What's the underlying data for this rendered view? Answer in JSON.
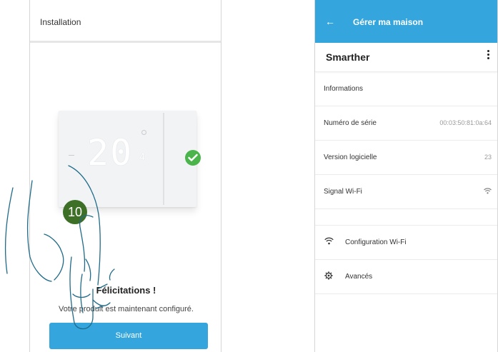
{
  "left": {
    "header_title": "Installation",
    "device_display": "20",
    "device_unit": "4",
    "step_number": "10",
    "congrats": "Félicitations !",
    "subtitle": "Votre produit est maintenant configuré.",
    "button": "Suivant"
  },
  "right": {
    "back_icon": "←",
    "header_title": "Gérer ma maison",
    "device_name": "Smarther",
    "section": "Informations",
    "rows": [
      {
        "label": "Numéro de série",
        "value": "00:03:50:81:0a:64"
      },
      {
        "label": "Version logicielle",
        "value": "23"
      },
      {
        "label": "Signal Wi-Fi",
        "value": ""
      }
    ],
    "actions": [
      {
        "label": "Configuration Wi-Fi",
        "icon": "wifi-icon"
      },
      {
        "label": "Avancés",
        "icon": "gear-icon"
      }
    ]
  },
  "colors": {
    "accent": "#35a6dd",
    "success": "#4bb44b",
    "badge": "#3d6f27"
  }
}
